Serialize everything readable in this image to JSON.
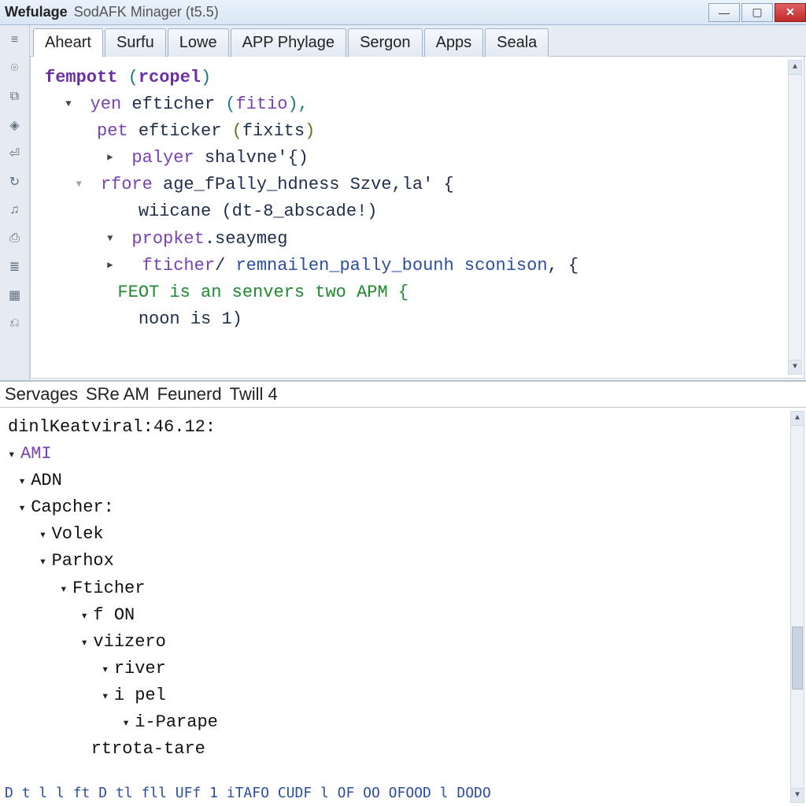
{
  "titlebar": {
    "appname": "Wefulage",
    "subtitle": "SodAFK Minager (t5.5)"
  },
  "tabs": [
    {
      "label": "Aheart",
      "active": true
    },
    {
      "label": "Surfu",
      "active": false
    },
    {
      "label": "Lowe",
      "active": false
    },
    {
      "label": "APP Phylage",
      "active": false
    },
    {
      "label": "Sergon",
      "active": false
    },
    {
      "label": "Apps",
      "active": false
    },
    {
      "label": "Seala",
      "active": false
    }
  ],
  "editor": {
    "l1_kw": "fempott",
    "l1_paren_open": "(",
    "l1_arg": "rcopel",
    "l1_paren_close": ")",
    "l2_kw": "yen",
    "l2_id": "efticher",
    "l2_po": "(",
    "l2_arg": "fitio",
    "l2_pc": "),",
    "l3_kw": "pet",
    "l3_id": "efticker",
    "l3_po": "(",
    "l3_arg": "fixits",
    "l3_pc": ")",
    "l4_kw": "palyer",
    "l4_rest": " shalvne'{)",
    "l5_kw": "rfore",
    "l5_rest": " age_fPally_hdness Szve,la' {",
    "l6_kw": "wiicane",
    "l6_rest": " (dt-8_abscade!)",
    "l7_kw": "propket",
    "l7_rest": ".seaymeg",
    "l8_kw": "fticher",
    "l8_slash": "/",
    "l8_fn": " remnailen_pally_bounh sconison",
    "l8_tail": ", {",
    "l9_a": "FEOT",
    "l9_b": " is an senvers two ",
    "l9_c": "APM",
    "l9_d": " {",
    "l10_a": "noon",
    "l10_b": " is ",
    "l10_c": "1",
    "l10_d": ")"
  },
  "midbar": {
    "w1": "Servages",
    "w2": "SRe AM",
    "w3": "Feunerd",
    "w4": "Twill 4"
  },
  "bottom": {
    "l1_key": "dinlKeatviral:",
    "l1_val": "46.12:",
    "l2": "AMI",
    "l3": "ADN",
    "l4": "Capcher:",
    "l5": "Volek",
    "l6": "Parhox",
    "l7": "Fticher",
    "l8": "f ON",
    "l9": "viizero",
    "l10": "river",
    "l11": "i pel",
    "l12": "i-Parape",
    "l13": "rtrota-tare"
  },
  "footer_hint": "D    t  l  l ft  D  tl fll  UFf   1  iTAFO CUDF      l OF  OO  OFOOD   l DODO"
}
